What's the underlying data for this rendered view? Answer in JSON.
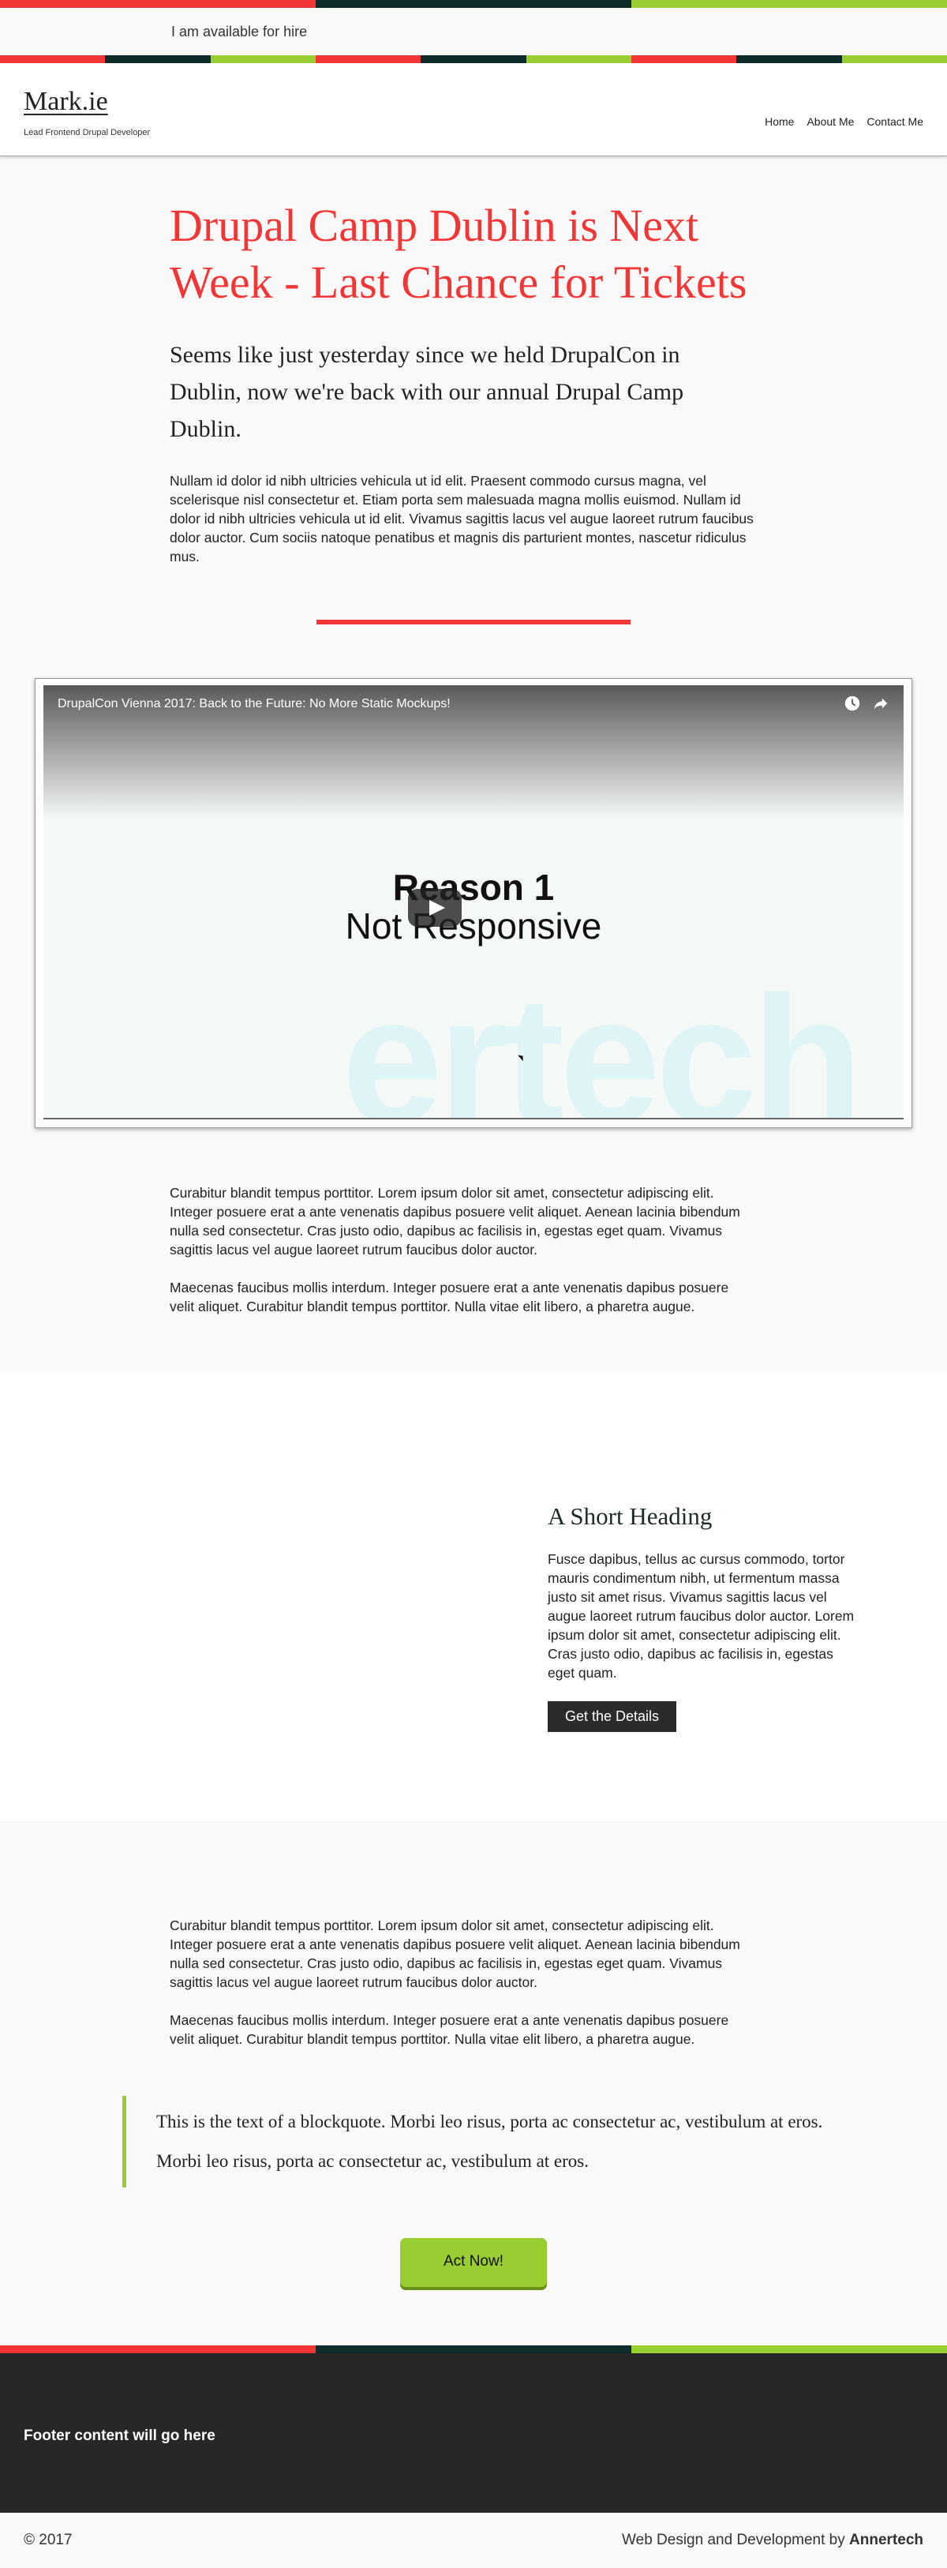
{
  "colors": {
    "red": "#f23535",
    "dark": "#0f2a2b",
    "green": "#9acd32",
    "footer_bg": "#272727"
  },
  "topbar": {
    "text": "I am available for hire"
  },
  "brand": {
    "name": "Mark.ie",
    "tagline": "Lead Frontend Drupal Developer"
  },
  "nav": {
    "items": [
      "Home",
      "About Me",
      "Contact Me"
    ]
  },
  "article": {
    "title": "Drupal Camp Dublin is Next Week - Last Chance for Tickets",
    "lead": "Seems like just yesterday since we held DrupalCon in Dublin, now we're back with our annual Drupal Camp Dublin.",
    "body": "Nullam id dolor id nibh ultricies vehicula ut id elit. Praesent commodo cursus magna, vel scelerisque nisl consectetur et. Etiam porta sem malesuada magna mollis euismod. Nullam id dolor id nibh ultricies vehicula ut id elit. Vivamus sagittis lacus vel augue laoreet rutrum faucibus dolor auctor. Cum sociis natoque penatibus et magnis dis parturient montes, nascetur ridiculus mus."
  },
  "video": {
    "title": "DrupalCon Vienna 2017: Back to the Future: No More Static Mockups!",
    "slide_heading": "Reason 1",
    "slide_sub": "Not Responsive",
    "watermark": "ertech",
    "icons": [
      "clock-icon",
      "share-icon",
      "play-icon"
    ]
  },
  "section2": {
    "p1": "Curabitur blandit tempus porttitor. Lorem ipsum dolor sit amet, consectetur adipiscing elit. Integer posuere erat a ante venenatis dapibus posuere velit aliquet. Aenean lacinia bibendum nulla sed consectetur. Cras justo odio, dapibus ac facilisis in, egestas eget quam. Vivamus sagittis lacus vel augue laoreet rutrum faucibus dolor auctor.",
    "p2": "Maecenas faucibus mollis interdum. Integer posuere erat a ante venenatis dapibus posuere velit aliquet. Curabitur blandit tempus porttitor. Nulla vitae elit libero, a pharetra augue."
  },
  "feature": {
    "heading": "A Short Heading",
    "text": "Fusce dapibus, tellus ac cursus commodo, tortor mauris condimentum nibh, ut fermentum massa justo sit amet risus. Vivamus sagittis lacus vel augue laoreet rutrum faucibus dolor auctor. Lorem ipsum dolor sit amet, consectetur adipiscing elit. Cras justo odio, dapibus ac facilisis in, egestas eget quam.",
    "button": "Get the Details"
  },
  "section3": {
    "p1": "Curabitur blandit tempus porttitor. Lorem ipsum dolor sit amet, consectetur adipiscing elit. Integer posuere erat a ante venenatis dapibus posuere velit aliquet. Aenean lacinia bibendum nulla sed consectetur. Cras justo odio, dapibus ac facilisis in, egestas eget quam. Vivamus sagittis lacus vel augue laoreet rutrum faucibus dolor auctor.",
    "p2": "Maecenas faucibus mollis interdum. Integer posuere erat a ante venenatis dapibus posuere velit aliquet. Curabitur blandit tempus porttitor. Nulla vitae elit libero, a pharetra augue.",
    "quote1": "This is the text of a blockquote. Morbi leo risus, porta ac consectetur ac, vestibulum at eros.",
    "quote2": "Morbi leo risus, porta ac consectetur ac, vestibulum at eros.",
    "cta": "Act Now!"
  },
  "footer": {
    "content": "Footer content will go here",
    "copyright": "© 2017",
    "credit_prefix": "Web Design and Development by",
    "credit_name": "Annertech"
  }
}
